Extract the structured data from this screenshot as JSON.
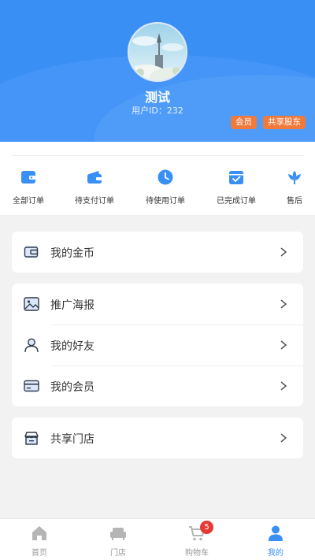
{
  "colors": {
    "primary": "#3a8ff5",
    "badge": "#f07a3c",
    "cart_badge": "#e53935"
  },
  "profile": {
    "avatar": "avatar-photo",
    "name": "测试",
    "user_id": "用户ID：232",
    "badges": [
      "会员",
      "共享股东"
    ]
  },
  "orders": [
    {
      "label": "全部订单",
      "icon": "wallet-icon"
    },
    {
      "label": "待支付订单",
      "icon": "wallet-open-icon"
    },
    {
      "label": "待使用订单",
      "icon": "clock-icon"
    },
    {
      "label": "已完成订单",
      "icon": "calendar-check-icon"
    },
    {
      "label": "售后",
      "icon": "flower-icon"
    }
  ],
  "menu": {
    "coins": {
      "label": "我的金币",
      "icon": "wallet-outline-icon"
    },
    "poster": {
      "label": "推广海报",
      "icon": "image-icon"
    },
    "friends": {
      "label": "我的好友",
      "icon": "user-icon"
    },
    "membership": {
      "label": "我的会员",
      "icon": "card-icon"
    },
    "store": {
      "label": "共享门店",
      "icon": "store-icon"
    }
  },
  "tabbar": {
    "items": [
      {
        "label": "首页",
        "icon": "home-icon"
      },
      {
        "label": "门店",
        "icon": "sofa-icon"
      },
      {
        "label": "购物车",
        "icon": "cart-icon"
      },
      {
        "label": "我的",
        "icon": "profile-icon"
      }
    ],
    "cart_count": "5",
    "active_index": 3
  }
}
